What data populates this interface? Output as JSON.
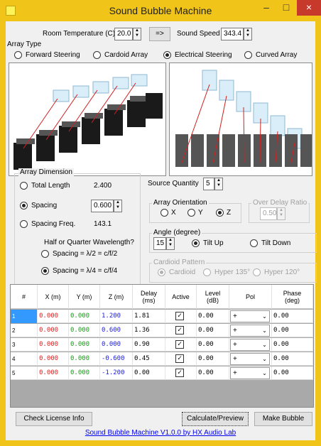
{
  "window": {
    "title": "Sound Bubble Machine",
    "accent": "#f0c419",
    "close_color": "#c7392b"
  },
  "icons": {
    "minimize": "minimize-icon",
    "maximize": "maximize-icon",
    "close": "close-icon",
    "app": "app-icon"
  },
  "glyphs": {
    "minimize": "–",
    "maximize": "□",
    "close": "×",
    "up": "▲",
    "down": "▼",
    "check": "✓",
    "combo": "⌄"
  },
  "room": {
    "temp_label": "Room Temperature (C)",
    "temp_value": "20.0",
    "convert_label": "=>",
    "speed_label": "Sound Speed",
    "speed_value": "343.4"
  },
  "array_type": {
    "title": "Array Type",
    "options": [
      "Forward Steering",
      "Cardoid Array",
      "Electrical Steering",
      "Curved Array"
    ],
    "selected": "Electrical Steering"
  },
  "array_dimension": {
    "title": "Array Dimension",
    "total_length_label": "Total Length",
    "total_length_value": "2.400",
    "spacing_label": "Spacing",
    "spacing_value": "0.600",
    "spacing_freq_label": "Spacing Freq.",
    "spacing_freq_value": "143.1",
    "selected": "Spacing",
    "wavelength_title": "Half or Quarter Wavelength?",
    "half_label": "Spacing = λ/2 = c/f/2",
    "quarter_label": "Spacing = λ/4 = c/f/4",
    "wavelength_selected": "quarter"
  },
  "source_quantity": {
    "label": "Source Quantity",
    "value": "5"
  },
  "orientation": {
    "title": "Array Orientation",
    "options": [
      "X",
      "Y",
      "Z"
    ],
    "selected": "Z"
  },
  "over_delay": {
    "title": "Over Delay Ratio",
    "value": "0.50"
  },
  "angle": {
    "title": "Angle (degree)",
    "value": "15",
    "tilt_up": "Tilt Up",
    "tilt_down": "Tilt Down",
    "selected": "Tilt Up"
  },
  "cardioid": {
    "title": "Cardioid Pattern",
    "options": [
      "Cardioid",
      "Hyper 135°",
      "Hyper 120°"
    ],
    "selected": "Cardioid"
  },
  "table": {
    "headers": [
      "#",
      "X (m)",
      "Y (m)",
      "Z (m)",
      "Delay (ms)",
      "Active",
      "Level (dB)",
      "Pol",
      "Phase (deg)"
    ],
    "rows": [
      {
        "num": "1",
        "x": "0.000",
        "y": "0.000",
        "z": "1.200",
        "delay": "1.81",
        "active": true,
        "level": "0.00",
        "pol": "+",
        "phase": "0.00"
      },
      {
        "num": "2",
        "x": "0.000",
        "y": "0.000",
        "z": "0.600",
        "delay": "1.36",
        "active": true,
        "level": "0.00",
        "pol": "+",
        "phase": "0.00"
      },
      {
        "num": "3",
        "x": "0.000",
        "y": "0.000",
        "z": "0.000",
        "delay": "0.90",
        "active": true,
        "level": "0.00",
        "pol": "+",
        "phase": "0.00"
      },
      {
        "num": "4",
        "x": "0.000",
        "y": "0.000",
        "z": "-0.600",
        "delay": "0.45",
        "active": true,
        "level": "0.00",
        "pol": "+",
        "phase": "0.00"
      },
      {
        "num": "5",
        "x": "0.000",
        "y": "0.000",
        "z": "-1.200",
        "delay": "0.00",
        "active": true,
        "level": "0.00",
        "pol": "+",
        "phase": "0.00"
      }
    ]
  },
  "buttons": {
    "license": "Check License Info",
    "calculate": "Calculate/Preview",
    "make": "Make Bubble"
  },
  "footer": {
    "link": "Sound Bubble Machine V1.0.0 by HX Audio Lab"
  }
}
